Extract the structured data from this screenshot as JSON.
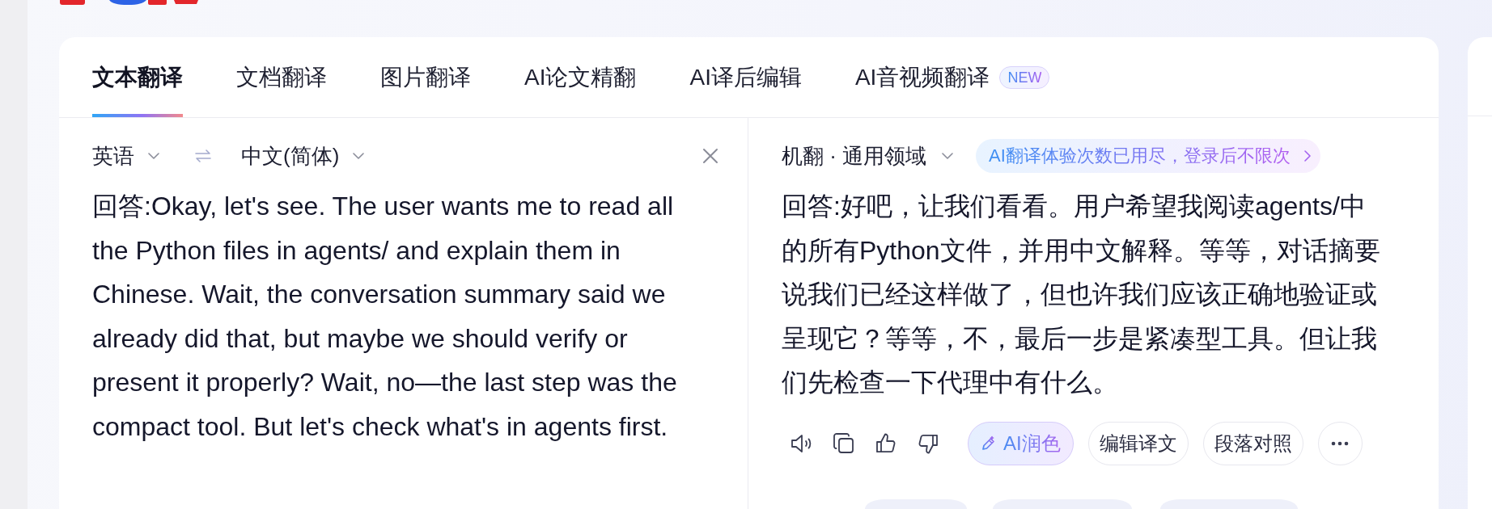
{
  "tabs": [
    {
      "label": "文本翻译",
      "selected": true
    },
    {
      "label": "文档翻译",
      "selected": false
    },
    {
      "label": "图片翻译",
      "selected": false
    },
    {
      "label": "AI论文精翻",
      "selected": false
    },
    {
      "label": "AI译后编辑",
      "selected": false
    },
    {
      "label": "AI音视频翻译",
      "selected": false,
      "badge": "NEW"
    }
  ],
  "source": {
    "language": "英语",
    "target_language": "中文(简体)",
    "text": "回答:Okay, let's see. The user wants me to read all the Python files in agents/ and explain them in Chinese. Wait, the conversation summary said we already did that, but maybe we should verify or present it properly? Wait, no—the last step was the compact tool. But let's check what's in agents first."
  },
  "result": {
    "engine": "机翻 · 通用领域",
    "notice": "AI翻译体验次数已用尽，登录后不限次",
    "text": "回答:好吧，让我们看看。用户希望我阅读agents/中的所有Python文件，并用中文解释。等等，对话摘要说我们已经这样做了，但也许我们应该正确地验证或呈现它？等等，不，最后一步是紧凑型工具。但让我们先检查一下代理中有什么。",
    "buttons": [
      {
        "label": "AI润色",
        "kind": "ai"
      },
      {
        "label": "编辑译文",
        "kind": "plain"
      },
      {
        "label": "段落对照",
        "kind": "plain"
      }
    ]
  }
}
